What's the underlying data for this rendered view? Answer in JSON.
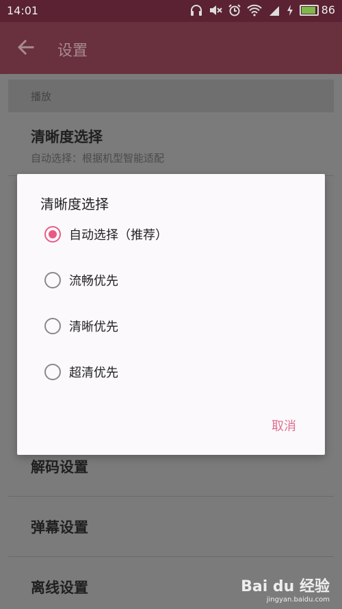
{
  "status": {
    "time": "14:01",
    "battery_level": "86",
    "battery_fraction": 0.86
  },
  "app_bar": {
    "title": "设置"
  },
  "settings": {
    "section_header": "播放",
    "items": [
      {
        "label": "清晰度选择",
        "sub": "自动选择：根据机型智能适配"
      },
      {
        "label": "解码设置"
      },
      {
        "label": "弹幕设置"
      },
      {
        "label": "离线设置"
      }
    ]
  },
  "dialog": {
    "title": "清晰度选择",
    "options": [
      {
        "label": "自动选择（推荐）",
        "selected": true
      },
      {
        "label": "流畅优先",
        "selected": false
      },
      {
        "label": "清晰优先",
        "selected": false
      },
      {
        "label": "超清优先",
        "selected": false
      }
    ],
    "cancel_label": "取消"
  },
  "watermark": {
    "brand": "Bai du 经验",
    "url": "jingyan.baidu.com"
  },
  "colors": {
    "accent": "#e85a84",
    "app_bar": "#69303d",
    "status_bar": "#5a2232"
  }
}
